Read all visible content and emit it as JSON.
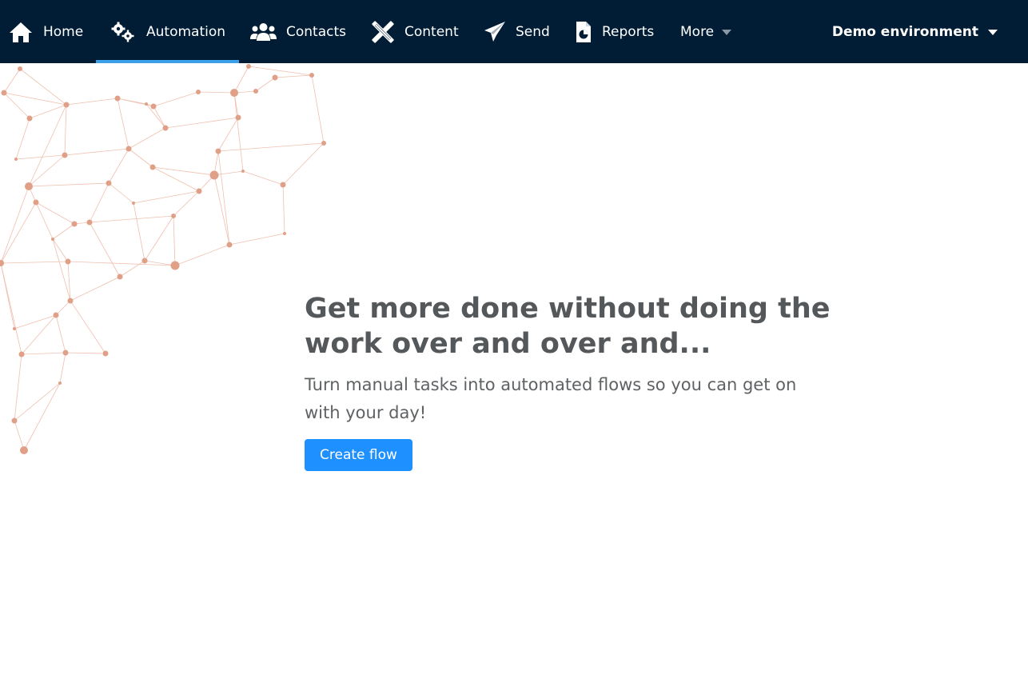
{
  "nav": {
    "items": [
      {
        "label": "Home",
        "icon": "home-icon"
      },
      {
        "label": "Automation",
        "icon": "gears-icon",
        "active": true
      },
      {
        "label": "Contacts",
        "icon": "users-icon"
      },
      {
        "label": "Content",
        "icon": "pencil-ruler-icon"
      },
      {
        "label": "Send",
        "icon": "paper-plane-icon"
      },
      {
        "label": "Reports",
        "icon": "report-file-icon"
      },
      {
        "label": "More",
        "icon": "caret-down-icon"
      }
    ],
    "environment": "Demo environment"
  },
  "hero": {
    "title": "Get more done without doing the work over and over and...",
    "subtitle": "Turn manual tasks into automated flows so you can get on with your day!",
    "cta_label": "Create flow"
  },
  "colors": {
    "nav_background": "#001d35",
    "active_indicator": "#3aa0e8",
    "primary_button": "#1e90ff",
    "network_dot": "#e0a088"
  }
}
